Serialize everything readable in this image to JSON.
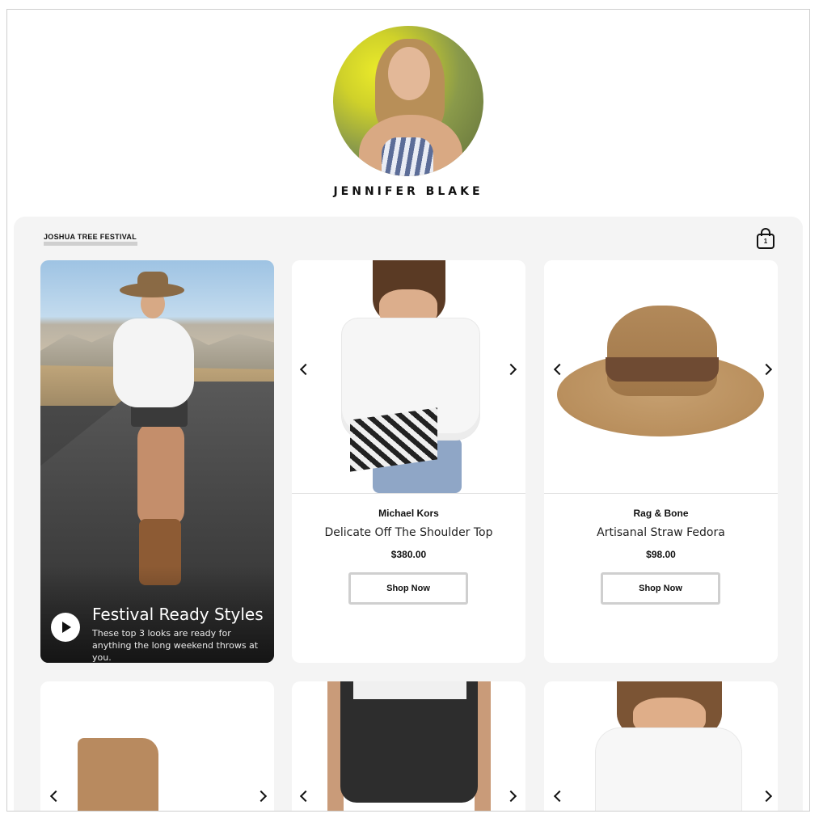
{
  "profile": {
    "name": "JENNIFER BLAKE"
  },
  "collection": {
    "title": "JOSHUA TREE FESTIVAL",
    "bag_count": "1"
  },
  "hero": {
    "title": "Festival Ready Styles",
    "subtitle": "These top 3 looks are ready for anything the long weekend throws at you."
  },
  "products": [
    {
      "brand": "Michael Kors",
      "name": "Delicate Off The Shoulder Top",
      "price": "$380.00",
      "cta": "Shop Now"
    },
    {
      "brand": "Rag & Bone",
      "name": "Artisanal Straw Fedora",
      "price": "$98.00",
      "cta": "Shop Now"
    }
  ],
  "icons": {
    "bag": "shopping-bag-icon",
    "play": "play-icon",
    "prev": "chevron-left-icon",
    "next": "chevron-right-icon"
  },
  "colors": {
    "panel_bg": "#f4f4f4",
    "button_border": "#cfcfcf",
    "text": "#111111"
  }
}
